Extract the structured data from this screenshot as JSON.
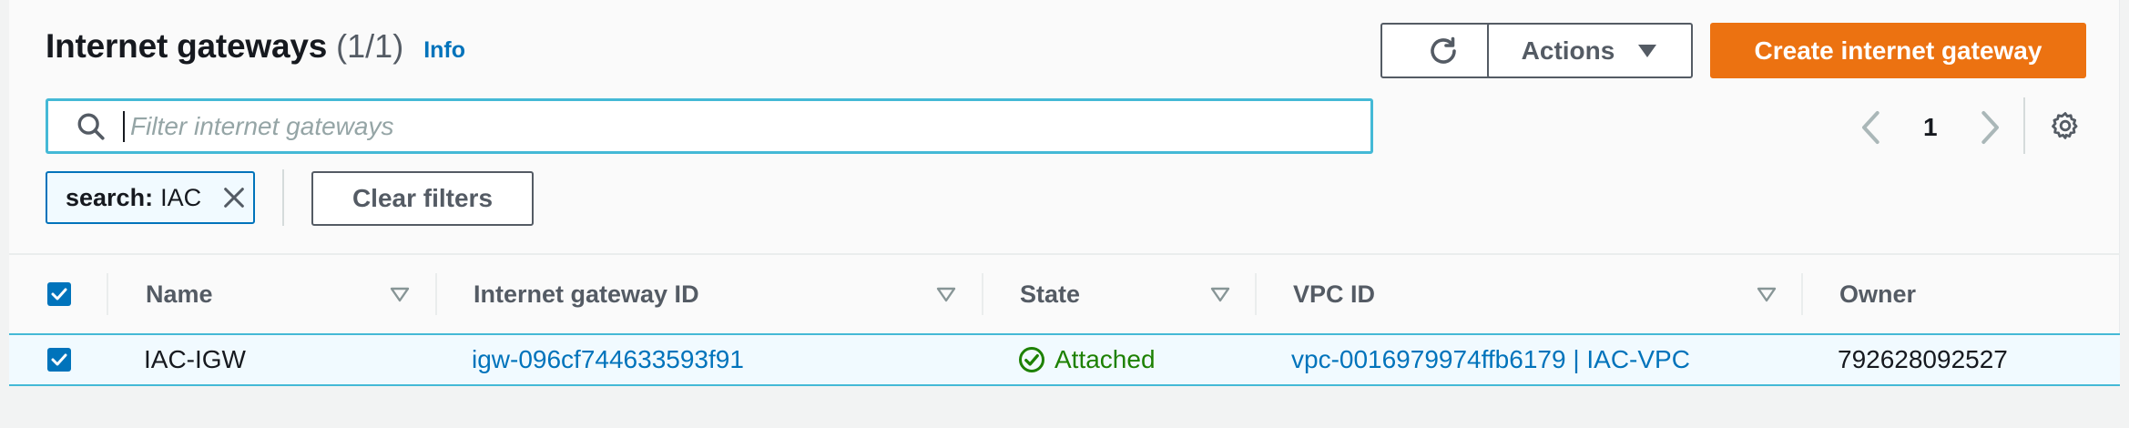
{
  "header": {
    "title": "Internet gateways",
    "count": "(1/1)",
    "info_label": "Info"
  },
  "toolbar": {
    "refresh_icon": "refresh-icon",
    "actions_label": "Actions",
    "create_label": "Create internet gateway",
    "create_color": "#ec7211"
  },
  "search": {
    "placeholder": "Filter internet gateways",
    "value": ""
  },
  "pagination": {
    "current_page": "1"
  },
  "filters": {
    "token_key": "search:",
    "token_value": "IAC",
    "clear_label": "Clear filters"
  },
  "table": {
    "columns": [
      "Name",
      "Internet gateway ID",
      "State",
      "VPC ID",
      "Owner"
    ],
    "rows": [
      {
        "selected": true,
        "name": "IAC-IGW",
        "gateway_id": "igw-096cf744633593f91",
        "state": "Attached",
        "vpc_id": "vpc-0016979974ffb6179 | IAC-VPC",
        "owner": "792628092527"
      }
    ]
  },
  "colors": {
    "link": "#0073bb",
    "success": "#1d8102",
    "selection_border": "#44b9d6"
  }
}
